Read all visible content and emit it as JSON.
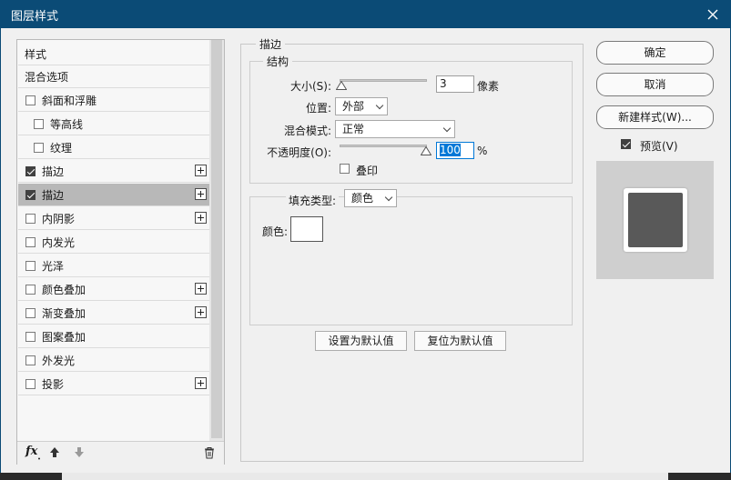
{
  "window": {
    "title": "图层样式",
    "close_label": "关闭"
  },
  "left_panel": {
    "items": [
      {
        "label": "样式",
        "checkbox": false
      },
      {
        "label": "混合选项",
        "checkbox": false
      },
      {
        "label": "斜面和浮雕",
        "checkbox": true,
        "checked": false,
        "indent": 0,
        "plus": false
      },
      {
        "label": "等高线",
        "checkbox": true,
        "checked": false,
        "indent": 1,
        "plus": false
      },
      {
        "label": "纹理",
        "checkbox": true,
        "checked": false,
        "indent": 1,
        "plus": false
      },
      {
        "label": "描边",
        "checkbox": true,
        "checked": true,
        "indent": 0,
        "plus": true
      },
      {
        "label": "描边",
        "checkbox": true,
        "checked": true,
        "indent": 0,
        "plus": true,
        "selected": true
      },
      {
        "label": "内阴影",
        "checkbox": true,
        "checked": false,
        "indent": 0,
        "plus": true
      },
      {
        "label": "内发光",
        "checkbox": true,
        "checked": false,
        "indent": 0,
        "plus": false
      },
      {
        "label": "光泽",
        "checkbox": true,
        "checked": false,
        "indent": 0,
        "plus": false
      },
      {
        "label": "颜色叠加",
        "checkbox": true,
        "checked": false,
        "indent": 0,
        "plus": true
      },
      {
        "label": "渐变叠加",
        "checkbox": true,
        "checked": false,
        "indent": 0,
        "plus": true
      },
      {
        "label": "图案叠加",
        "checkbox": true,
        "checked": false,
        "indent": 0,
        "plus": false
      },
      {
        "label": "外发光",
        "checkbox": true,
        "checked": false,
        "indent": 0,
        "plus": false
      },
      {
        "label": "投影",
        "checkbox": true,
        "checked": false,
        "indent": 0,
        "plus": true
      }
    ],
    "bottom": {
      "fx_label": "fx",
      "move_up_icon": "arrow-up-icon",
      "move_down_icon": "arrow-down-icon",
      "delete_icon": "trash-icon"
    }
  },
  "stroke": {
    "section_title": "描边",
    "structure_title": "结构",
    "size_label": "大小(S):",
    "size_value": "3",
    "size_unit": "像素",
    "position_label": "位置:",
    "position_value": "外部",
    "blend_label": "混合模式:",
    "blend_value": "正常",
    "opacity_label": "不透明度(O):",
    "opacity_value": "100",
    "opacity_unit": "%",
    "overprint_label": "叠印",
    "overprint_checked": false,
    "fill_type_label": "填充类型:",
    "fill_type_value": "颜色",
    "color_label": "颜色:",
    "color_value": "#ffffff",
    "set_default_label": "设置为默认值",
    "reset_default_label": "复位为默认值"
  },
  "right_panel": {
    "ok_label": "确定",
    "cancel_label": "取消",
    "new_style_label": "新建样式(W)...",
    "preview_label": "预览(V)",
    "preview_checked": true
  },
  "colors": {
    "titlebar": "#0b4b76",
    "selected_item": "#b8b8b8",
    "preview_swatch": "#595959",
    "preview_bg": "#cfcfcf"
  }
}
